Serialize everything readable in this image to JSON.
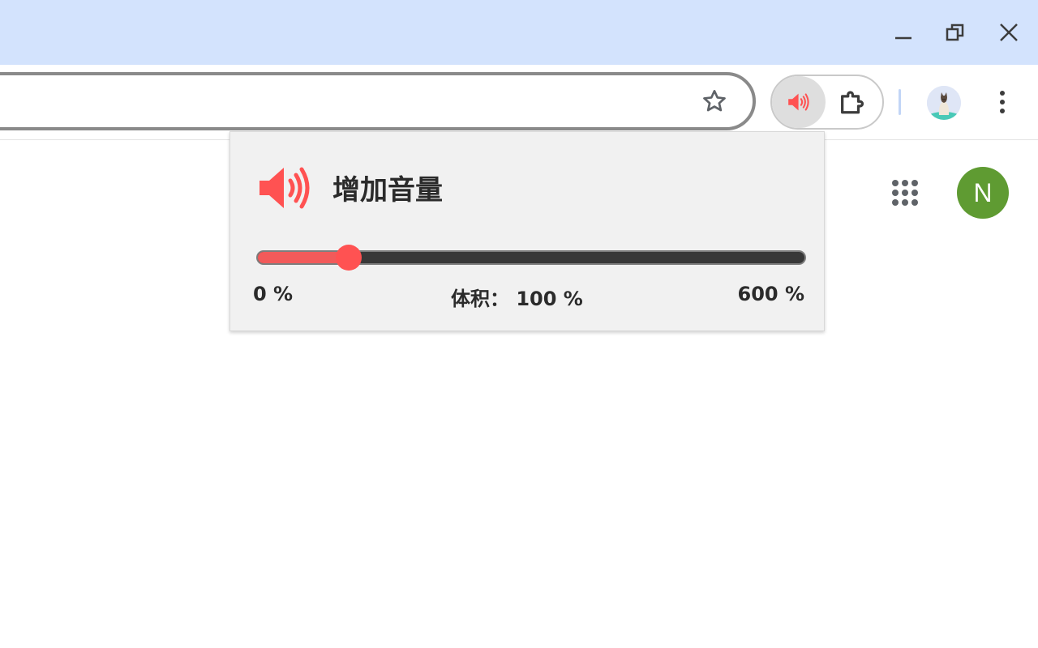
{
  "window": {
    "controls": [
      "minimize-icon",
      "restore-icon",
      "close-icon"
    ]
  },
  "toolbar": {
    "bookmark_icon": "star-icon",
    "extension_active_icon": "speaker-icon",
    "extensions_icon": "puzzle-icon",
    "menu_icon": "kebab-icon"
  },
  "page": {
    "apps_icon": "apps-grid-icon",
    "account_initial": "N",
    "account_color": "#5f9b32"
  },
  "popup": {
    "icon": "speaker-icon",
    "title": "增加音量",
    "slider": {
      "min_label": "0 %",
      "current_label": "体积： 100 %",
      "max_label": "600 %",
      "min": 0,
      "max": 600,
      "value": 100
    },
    "accent_color": "#ff5252"
  }
}
